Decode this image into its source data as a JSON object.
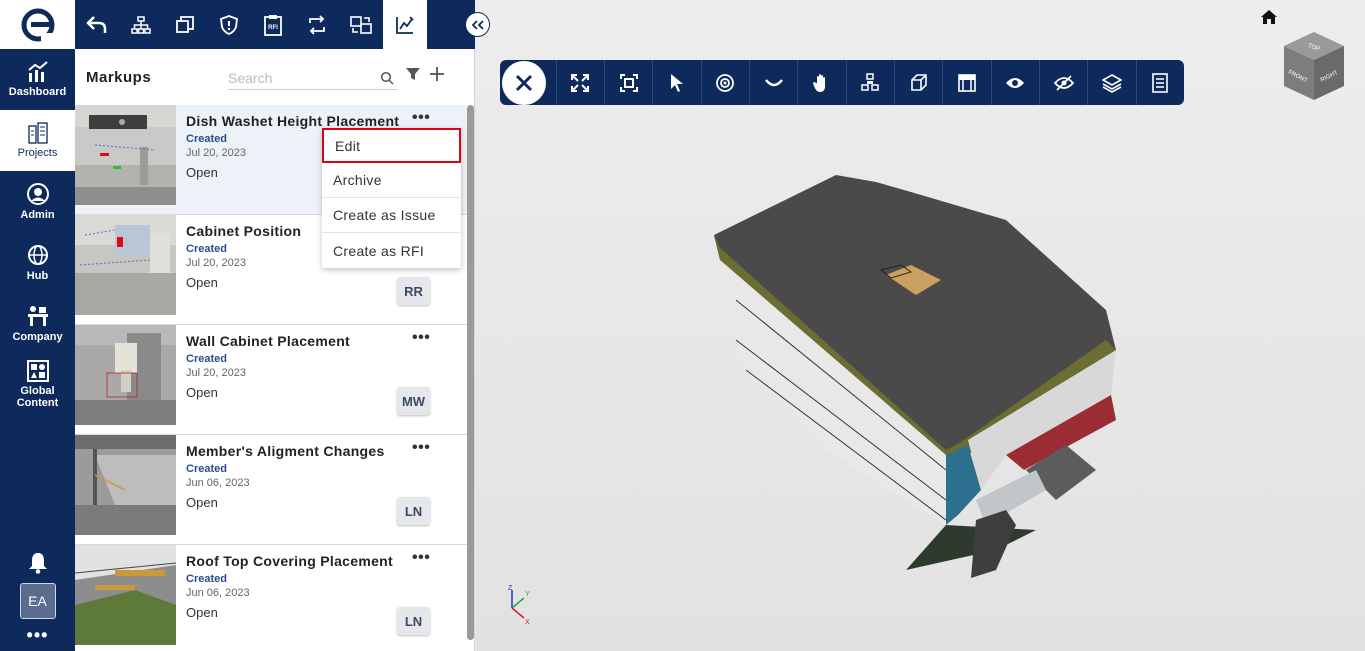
{
  "nav": {
    "items": [
      {
        "label": "Dashboard",
        "icon": "chart-icon"
      },
      {
        "label": "Projects",
        "icon": "buildings-icon"
      },
      {
        "label": "Admin",
        "icon": "user-circle-icon"
      },
      {
        "label": "Hub",
        "icon": "globe-icon"
      },
      {
        "label": "Company",
        "icon": "company-icon"
      },
      {
        "label": "Global Content",
        "icon": "grid-icon"
      }
    ],
    "avatar": "EA",
    "more": "•••"
  },
  "toolbar": {
    "icons": [
      "undo-icon",
      "hierarchy-icon",
      "layers-icon",
      "shield-icon",
      "rfi-icon",
      "sync-icon",
      "compare-icon",
      "markup-icon"
    ]
  },
  "panel": {
    "title": "Markups",
    "search_placeholder": "Search"
  },
  "markups": [
    {
      "title": "Dish Washet Height Placement",
      "status": "Created",
      "date": "Jul 20, 2023",
      "state": "Open",
      "initials": ""
    },
    {
      "title": "Cabinet Position",
      "status": "Created",
      "date": "Jul 20, 2023",
      "state": "Open",
      "initials": "RR"
    },
    {
      "title": "Wall Cabinet Placement",
      "status": "Created",
      "date": "Jul 20, 2023",
      "state": "Open",
      "initials": "MW"
    },
    {
      "title": "Member's Aligment Changes",
      "status": "Created",
      "date": "Jun 06, 2023",
      "state": "Open",
      "initials": "LN"
    },
    {
      "title": "Roof Top Covering Placement",
      "status": "Created",
      "date": "Jun 06, 2023",
      "state": "Open",
      "initials": "LN"
    }
  ],
  "context_menu": [
    "Edit",
    "Archive",
    "Create as Issue",
    "Create as RFI"
  ],
  "viewer": {
    "cube_faces": [
      "TOP",
      "FRONT",
      "RIGHT"
    ],
    "axes": [
      "Z",
      "Y",
      "X"
    ]
  },
  "colors": {
    "navy": "#0e2a5c",
    "highlight": "#e00010",
    "status": "#2a4c8a"
  }
}
